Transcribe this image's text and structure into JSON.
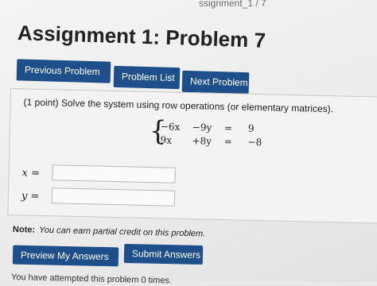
{
  "header": {
    "crumb": "ssignment_1 / 7",
    "title": "Assignment 1: Problem 7"
  },
  "nav": {
    "previous_label": "Previous Problem",
    "list_label": "Problem List",
    "next_label": "Next Problem"
  },
  "problem": {
    "statement": "(1 point) Solve the system using row operations (or elementary matrices).",
    "equations": [
      {
        "a": "−6x",
        "b": "−9y",
        "op": "=",
        "rhs": "9"
      },
      {
        "a": "9x",
        "b": "+8y",
        "op": "=",
        "rhs": "−8"
      }
    ],
    "answers": [
      {
        "label": "x =",
        "value": ""
      },
      {
        "label": "y =",
        "value": ""
      }
    ]
  },
  "note": {
    "bold": "Note:",
    "text": "You can earn partial credit on this problem."
  },
  "actions": {
    "preview_label": "Preview My Answers",
    "submit_label": "Submit Answers"
  },
  "attempts": "You have attempted this problem 0 times."
}
